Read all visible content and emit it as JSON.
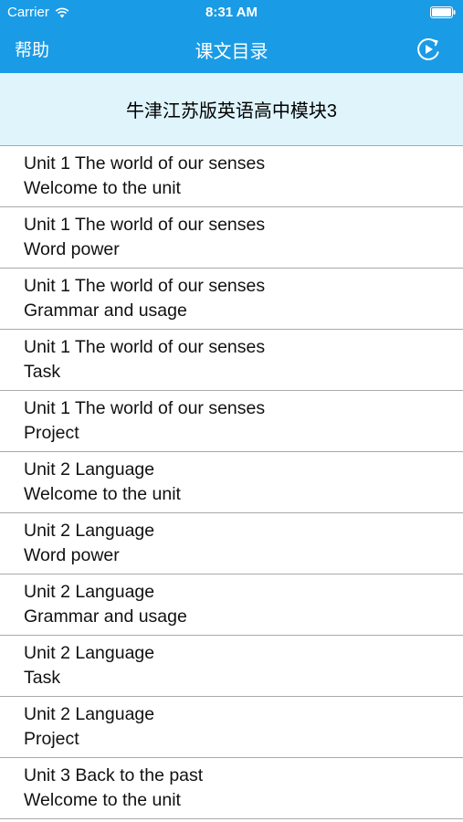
{
  "status_bar": {
    "carrier": "Carrier",
    "time": "8:31 AM"
  },
  "nav": {
    "help_label": "帮助",
    "title": "课文目录"
  },
  "book_title": "牛津江苏版英语高中模块3",
  "lessons": [
    {
      "unit": "Unit 1 The world of our senses",
      "section": "Welcome to the unit"
    },
    {
      "unit": "Unit 1 The world of our senses",
      "section": "Word power"
    },
    {
      "unit": "Unit 1 The world of our senses",
      "section": "Grammar and usage"
    },
    {
      "unit": "Unit 1 The world of our senses",
      "section": "Task"
    },
    {
      "unit": "Unit 1 The world of our senses",
      "section": "Project"
    },
    {
      "unit": "Unit 2 Language",
      "section": "Welcome to the unit"
    },
    {
      "unit": "Unit 2 Language",
      "section": "Word power"
    },
    {
      "unit": "Unit 2 Language",
      "section": "Grammar and usage"
    },
    {
      "unit": "Unit 2 Language",
      "section": "Task"
    },
    {
      "unit": "Unit 2 Language",
      "section": "Project"
    },
    {
      "unit": "Unit 3 Back to the past",
      "section": "Welcome to the unit"
    }
  ],
  "colors": {
    "nav_background": "#1a9be5",
    "header_background": "#dff4fb",
    "separator": "#a9a9a9"
  }
}
